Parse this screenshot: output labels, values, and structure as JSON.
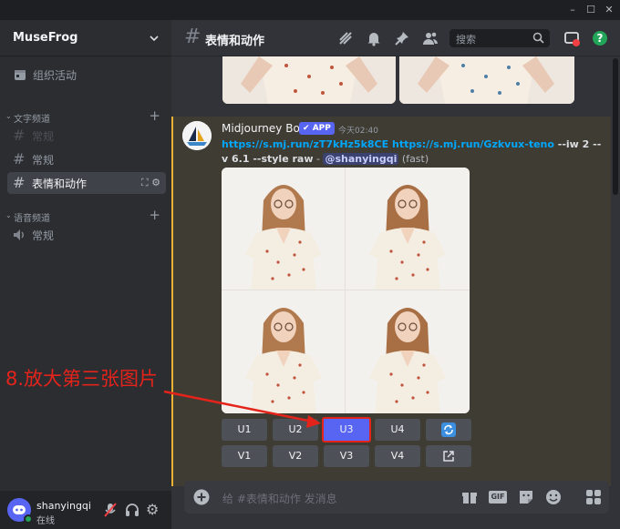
{
  "window": {
    "controls": [
      "–",
      "☐",
      "✕"
    ]
  },
  "sidebar": {
    "server_name": "MuseFrog",
    "events_label": "组织活动",
    "text_category": "文字频道",
    "voice_category": "语音频道",
    "text_channels": [
      {
        "label": "常规",
        "muted": true
      },
      {
        "label": "常规",
        "muted": false
      },
      {
        "label": "表情和动作",
        "active": true
      }
    ],
    "voice_channels": [
      {
        "label": "常规"
      }
    ]
  },
  "user": {
    "name": "shanyingqi",
    "status": "在线"
  },
  "chat": {
    "channel_title": "表情和动作",
    "search_placeholder": "搜索",
    "composer_placeholder": "给 #表情和动作 发消息",
    "gif_label": "GIF"
  },
  "message": {
    "author": "Midjourney Bot",
    "badge": "APP",
    "time": "今天02:40",
    "link1": "https://s.mj.run/zT7kHz5k8CE",
    "link2": "https://s.mj.run/Gzkvux-teno",
    "params1": " --iw 2 --",
    "params2": "v 6.1 --style raw",
    "dash": " - ",
    "mention": "@shanyingqi",
    "speed": " (fast)"
  },
  "buttons": {
    "row1": [
      "U1",
      "U2",
      "U3",
      "U4"
    ],
    "row2": [
      "V1",
      "V2",
      "V3",
      "V4"
    ],
    "highlighted": "U3"
  },
  "annotation": {
    "text": "8.放大第三张图片",
    "color": "#e4231b"
  },
  "colors": {
    "accent": "#5865f2",
    "online": "#23a559",
    "link": "#00a8fc",
    "highlight_bar": "#f0b232"
  }
}
